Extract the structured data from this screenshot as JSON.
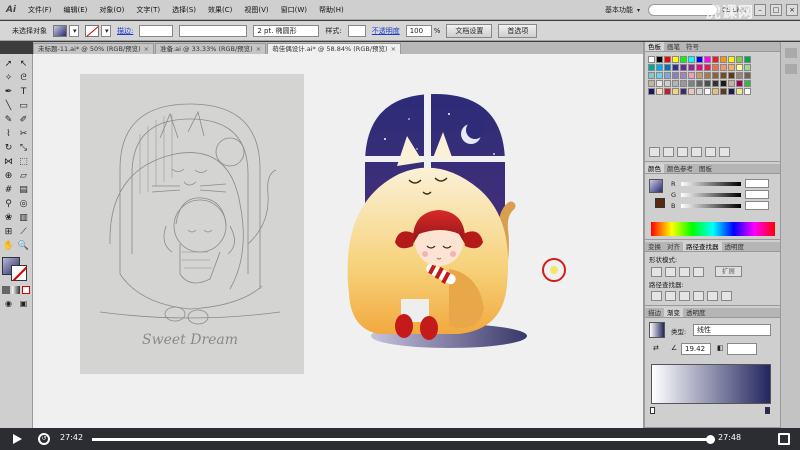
{
  "menu": {
    "app_name": "Ai",
    "items": [
      "文件(F)",
      "编辑(E)",
      "对象(O)",
      "文字(T)",
      "选择(S)",
      "效果(C)",
      "视图(V)",
      "窗口(W)",
      "帮助(H)"
    ],
    "workspace": "基本功能",
    "cs_live": "CS Live"
  },
  "controlbar": {
    "selection_status": "未选择对象",
    "stroke_label": "描边:",
    "brush_size": "2 pt. 椭圆形",
    "style_label": "样式:",
    "opacity_label": "不透明度",
    "opacity_value": "100",
    "opacity_unit": "%",
    "doc_settings_button": "文档设置",
    "preferences_button": "首选项"
  },
  "doc_tabs": [
    {
      "label": "未标题-11.ai* @ 50% (RGB/预览)",
      "active": false
    },
    {
      "label": "准备.ai @ 33.33% (RGB/预览)",
      "active": false
    },
    {
      "label": "萌佳偶设计.ai* @ 58.84% (RGB/预览)",
      "active": true
    }
  ],
  "watermark": "虎课网",
  "sketch_caption": "Sweet Dream",
  "panels": {
    "swatches": {
      "tabs": [
        "色板",
        "画笔",
        "符号"
      ],
      "colors": [
        "#ffffff",
        "#000000",
        "#ff0000",
        "#ffff00",
        "#00ff00",
        "#00ffff",
        "#0000ff",
        "#ff00ff",
        "#ed1c24",
        "#f7941d",
        "#fff200",
        "#8dc63f",
        "#00a651",
        "#00a99d",
        "#00aeef",
        "#0072bc",
        "#2e3192",
        "#662d91",
        "#92278f",
        "#ec008c",
        "#ed145b",
        "#f26c4f",
        "#f69679",
        "#fbaf5d",
        "#fff799",
        "#a3d39c",
        "#7accc8",
        "#6dcff6",
        "#7da7d9",
        "#8781bd",
        "#a186be",
        "#f49ac1",
        "#c69c6d",
        "#a67c52",
        "#8c6239",
        "#754c24",
        "#603913",
        "#998675",
        "#736357",
        "#c2b59b",
        "#e6e6e6",
        "#cccccc",
        "#b3b3b3",
        "#999999",
        "#808080",
        "#666666",
        "#4d4d4d",
        "#333333",
        "#1a1a1a",
        "#c7b299",
        "#9e005d",
        "#39b54a",
        "#1b1464",
        "#ffe0b2",
        "#bf1e2e",
        "#f9d27c",
        "#3a2d6b",
        "#f4c2c2",
        "#d4d4d4",
        "#fafafa",
        "#e8c07a",
        "#5a3b1e",
        "#1d1a4e",
        "#f0e68c",
        "#ffffff"
      ]
    },
    "color": {
      "tabs": [
        "颜色",
        "颜色参考",
        "图板"
      ],
      "channels": [
        "R",
        "G",
        "B"
      ]
    },
    "pathfinder": {
      "tabs": [
        "变换",
        "对齐",
        "路径查找器",
        "透明度"
      ],
      "shape_modes_label": "形状模式:",
      "expand_button": "扩展",
      "pathfinders_label": "路径查找器:"
    },
    "gradient": {
      "tabs": [
        "描边",
        "渐变",
        "透明度"
      ],
      "type_label": "类型:",
      "type_value": "线性",
      "angle_value": "19.42",
      "colors": {
        "start": "#ffffff",
        "end": "#23265f"
      }
    }
  },
  "player": {
    "current_time": "27:42",
    "total_time": "27:48",
    "progress": 0.996
  }
}
